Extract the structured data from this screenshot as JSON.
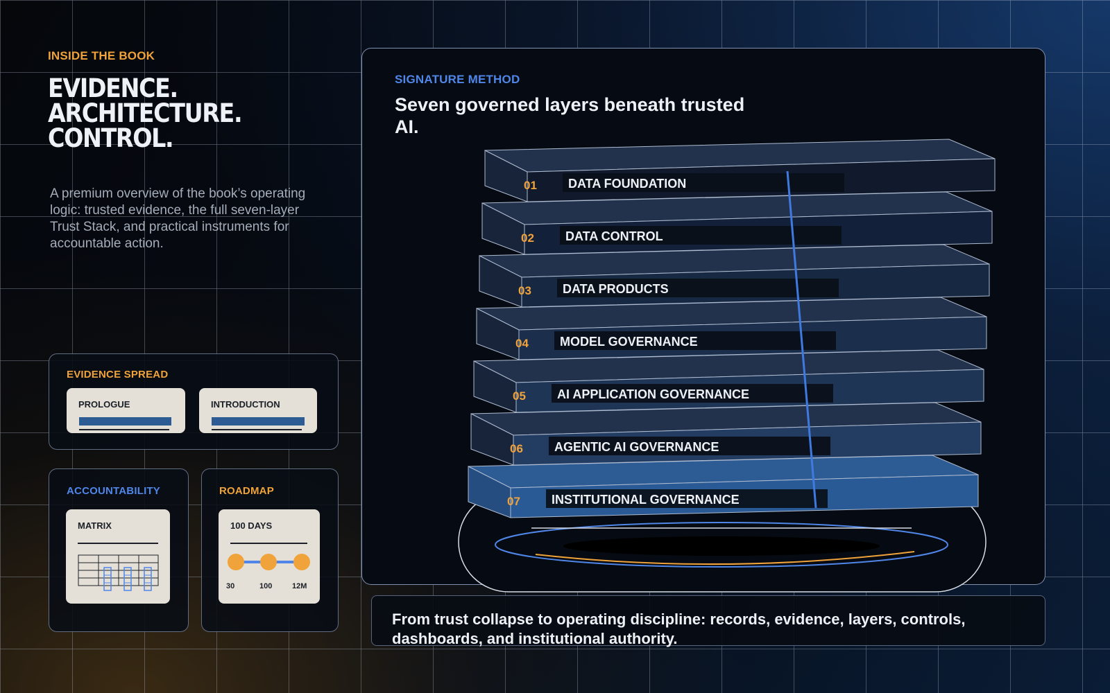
{
  "colors": {
    "accent_orange": "#f0a33a",
    "accent_blue": "#4f86e8",
    "layer_top": "#2d5c95",
    "card_bg": "#e4e0d7"
  },
  "hero": {
    "kicker": "INSIDE THE BOOK",
    "title_lines": [
      "EVIDENCE.",
      "ARCHITECTURE.",
      "CONTROL."
    ],
    "description": "A premium overview of the book’s operating logic: trusted evidence, the full seven-layer Trust Stack, and practical instruments for accountable action."
  },
  "evidence_spread": {
    "kicker": "EVIDENCE SPREAD",
    "cards": [
      "PROLOGUE",
      "INTRODUCTION"
    ]
  },
  "accountability": {
    "kicker": "ACCOUNTABILITY",
    "card_title": "MATRIX",
    "icon": "matrix-grid-icon"
  },
  "roadmap": {
    "kicker": "ROADMAP",
    "card_title": "100 DAYS",
    "milestones": [
      "30",
      "100",
      "12M"
    ]
  },
  "signature": {
    "kicker": "SIGNATURE METHOD",
    "title": "Seven governed layers beneath trusted AI.",
    "layers": [
      {
        "number": "07",
        "label": "INSTITUTIONAL GOVERNANCE"
      },
      {
        "number": "06",
        "label": "AGENTIC AI GOVERNANCE"
      },
      {
        "number": "05",
        "label": "AI APPLICATION GOVERNANCE"
      },
      {
        "number": "04",
        "label": "MODEL GOVERNANCE"
      },
      {
        "number": "03",
        "label": "DATA PRODUCTS"
      },
      {
        "number": "02",
        "label": "DATA CONTROL"
      },
      {
        "number": "01",
        "label": "DATA FOUNDATION"
      }
    ]
  },
  "footer": {
    "text": "From trust collapse to operating discipline: records, evidence, layers, controls, dashboards, and institutional authority."
  }
}
